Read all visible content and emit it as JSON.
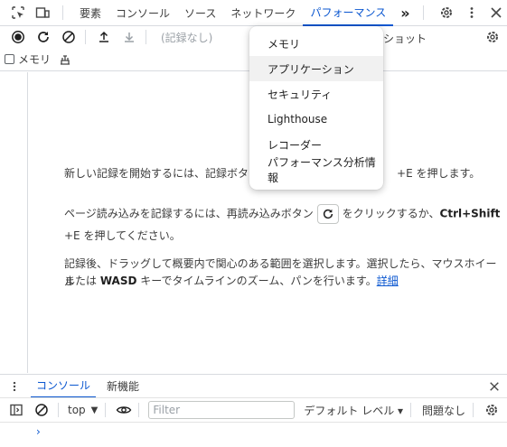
{
  "tabs": [
    {
      "label": "要素"
    },
    {
      "label": "コンソール"
    },
    {
      "label": "ソース"
    },
    {
      "label": "ネットワーク"
    },
    {
      "label": "パフォーマンス"
    }
  ],
  "overflow_label": "»",
  "toolbar": {
    "recordings_placeholder": "(記録なし)",
    "screenshot_label": "ショット"
  },
  "toolbar2": {
    "memory_label": "メモリ"
  },
  "menu": {
    "items": [
      {
        "label": "メモリ"
      },
      {
        "label": "アプリケーション"
      },
      {
        "label": "セキュリティ"
      },
      {
        "label": "Lighthouse"
      },
      {
        "label": "レコーダー"
      },
      {
        "label": "パフォーマンス分析情報"
      }
    ]
  },
  "instructions": {
    "line1_prefix": "新しい記録を開始するには、記録ボタン",
    "line1_suffix": "+E を押します。",
    "line2_prefix": "ページ読み込みを記録するには、再読み込みボタン",
    "line2_middle": "をクリックするか、",
    "line2_shortcut": "Ctrl+Shift",
    "line3": "+E を押してください。",
    "line4": "記録後、ドラッグして概要内で関心のある範囲を選択します。選択したら、マウスホイール",
    "line5_prefix": "または ",
    "line5_key": "WASD",
    "line5_middle": " キーでタイムラインのズーム、パンを行います。",
    "line5_link": "詳細"
  },
  "drawer": {
    "tabs": [
      {
        "label": "コンソール"
      },
      {
        "label": "新機能"
      }
    ],
    "context": "top",
    "filter_placeholder": "Filter",
    "levels": "デフォルト レベル ▾",
    "issues": "問題なし",
    "prompt": "›"
  },
  "colors": {
    "accent": "#0b57d0",
    "border": "#d8dbe0"
  }
}
